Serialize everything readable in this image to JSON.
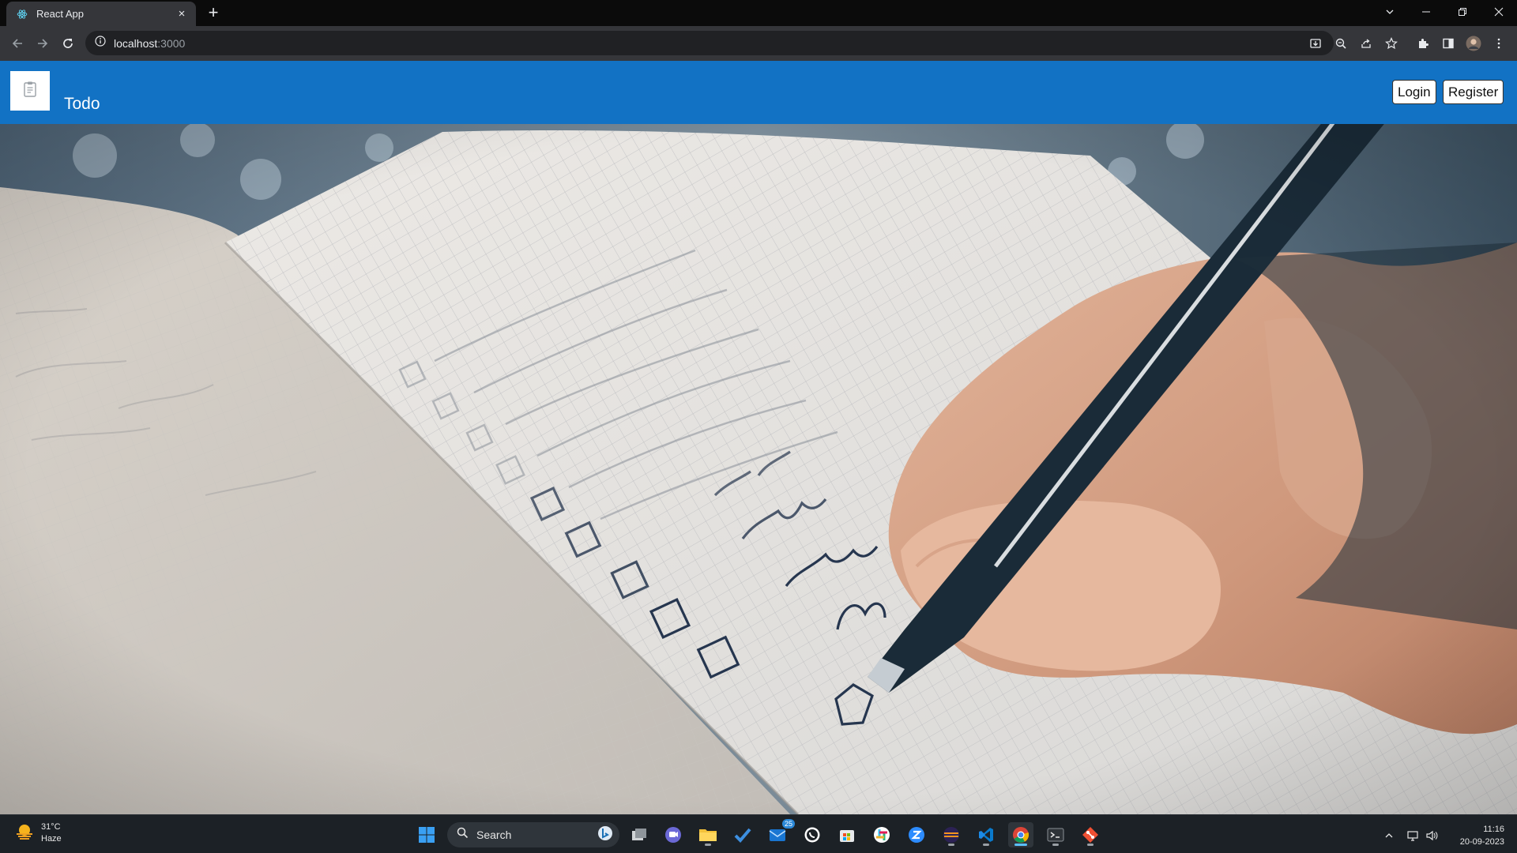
{
  "browser": {
    "tab": {
      "title": "React App",
      "close_glyph": "×",
      "favicon": "react-icon"
    },
    "new_tab_glyph": "+",
    "omnibox": {
      "host": "localhost",
      "port": ":3000"
    },
    "window_controls": [
      "chevron-down-icon",
      "minimize-icon",
      "restore-icon",
      "close-icon"
    ]
  },
  "app": {
    "brand": "Todo",
    "logo_icon": "clipboard-icon",
    "login_label": "Login",
    "register_label": "Register",
    "header_color": "#1272c4"
  },
  "hero": {
    "description_icon": "notebook-checklist-photo",
    "checklist_words": [
      "Drive",
      "Drive",
      "Mo"
    ]
  },
  "taskbar": {
    "weather": {
      "temp": "31°C",
      "condition": "Haze"
    },
    "search_label": "Search",
    "mail_badge": "25",
    "clock": {
      "time": "11:16",
      "date": "20-09-2023"
    }
  }
}
